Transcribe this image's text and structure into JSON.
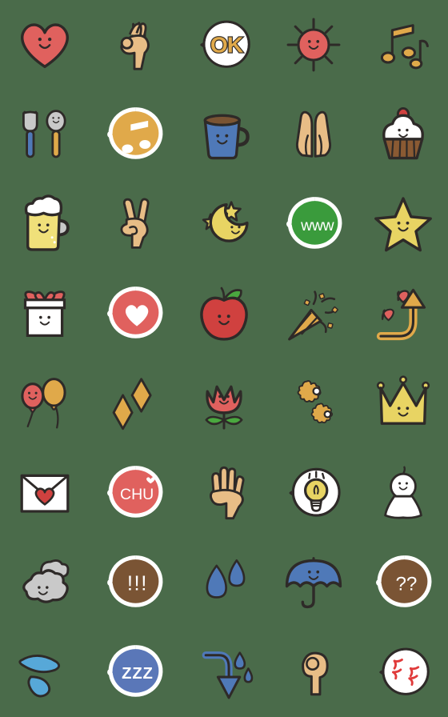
{
  "sheet": {
    "title": "Cute doodle emoji sticker sheet",
    "background_color": "#4a6b4a",
    "columns": 5,
    "rows": 8,
    "cell_size_px": 112,
    "palette": {
      "outline": "#2e2a28",
      "red": "#e0615e",
      "deep_red": "#d0413f",
      "skin": "#e8bd86",
      "gold": "#e0a94a",
      "yellow": "#e8d463",
      "pale_yellow": "#f0e07a",
      "blue": "#4f79b8",
      "deep_blue": "#3a5f9e",
      "light_blue": "#57a8d8",
      "green": "#3a9b3c",
      "leaf_green": "#4aa83f",
      "brown": "#7a5434",
      "dark_brown": "#8a5a33",
      "white": "#ffffff",
      "grey": "#c9c9c9",
      "anger_red": "#e03b3b"
    }
  },
  "emoji": [
    {
      "id": 1,
      "row": 1,
      "col": 1,
      "name": "smiling-heart",
      "label": "Smiling red heart",
      "text": "",
      "colors": [
        "#e0615e"
      ]
    },
    {
      "id": 2,
      "row": 1,
      "col": 2,
      "name": "ok-hand-sign",
      "label": "OK hand gesture",
      "text": "",
      "colors": [
        "#e8bd86"
      ]
    },
    {
      "id": 3,
      "row": 1,
      "col": 3,
      "name": "ok-speech-bubble",
      "label": "OK speech bubble",
      "text": "OK",
      "colors": [
        "#ffffff",
        "#e0a94a"
      ]
    },
    {
      "id": 4,
      "row": 1,
      "col": 4,
      "name": "smiling-sun",
      "label": "Smiling sun",
      "text": "",
      "colors": [
        "#e0615e"
      ]
    },
    {
      "id": 5,
      "row": 1,
      "col": 5,
      "name": "music-notes",
      "label": "Two music notes",
      "text": "",
      "colors": [
        "#e0a94a"
      ]
    },
    {
      "id": 6,
      "row": 2,
      "col": 1,
      "name": "fork-and-spoon",
      "label": "Fork and smiling spoon",
      "text": "",
      "colors": [
        "#c9c9c9",
        "#4f79b8",
        "#e0a94a"
      ]
    },
    {
      "id": 7,
      "row": 2,
      "col": 2,
      "name": "music-note-bubble",
      "label": "Music note speech bubble",
      "text": "",
      "colors": [
        "#e0a94a",
        "#ffffff"
      ]
    },
    {
      "id": 8,
      "row": 2,
      "col": 3,
      "name": "smiling-coffee-mug",
      "label": "Smiling blue coffee mug",
      "text": "",
      "colors": [
        "#4f79b8",
        "#7a5434"
      ]
    },
    {
      "id": 9,
      "row": 2,
      "col": 4,
      "name": "praying-hands",
      "label": "Praying hands",
      "text": "",
      "colors": [
        "#e8bd86"
      ]
    },
    {
      "id": 10,
      "row": 2,
      "col": 5,
      "name": "smiling-cupcake",
      "label": "Smiling cupcake with cherry",
      "text": "",
      "colors": [
        "#ffffff",
        "#8a5a33",
        "#d0413f"
      ]
    },
    {
      "id": 11,
      "row": 3,
      "col": 1,
      "name": "smiling-beer-mug",
      "label": "Smiling beer mug",
      "text": "",
      "colors": [
        "#e8d463",
        "#ffffff"
      ]
    },
    {
      "id": 12,
      "row": 3,
      "col": 2,
      "name": "peace-sign-hand",
      "label": "Peace / victory hand",
      "text": "",
      "colors": [
        "#e8bd86"
      ]
    },
    {
      "id": 13,
      "row": 3,
      "col": 3,
      "name": "crescent-moon-stars",
      "label": "Smiling crescent moon with stars",
      "text": "",
      "colors": [
        "#e8d463"
      ]
    },
    {
      "id": 14,
      "row": 3,
      "col": 4,
      "name": "www-speech-bubble",
      "label": "Laughing www speech bubble",
      "text": "www",
      "colors": [
        "#3a9b3c",
        "#ffffff"
      ]
    },
    {
      "id": 15,
      "row": 3,
      "col": 5,
      "name": "smiling-star",
      "label": "Smiling gold star",
      "text": "",
      "colors": [
        "#e8d463"
      ]
    },
    {
      "id": 16,
      "row": 4,
      "col": 1,
      "name": "smiling-gift-box",
      "label": "Smiling gift box with red ribbon",
      "text": "",
      "colors": [
        "#ffffff",
        "#e0615e"
      ]
    },
    {
      "id": 17,
      "row": 4,
      "col": 2,
      "name": "heart-speech-bubble",
      "label": "Heart speech bubble",
      "text": "",
      "colors": [
        "#e0615e",
        "#ffffff"
      ]
    },
    {
      "id": 18,
      "row": 4,
      "col": 3,
      "name": "smiling-apple",
      "label": "Smiling red apple",
      "text": "",
      "colors": [
        "#d0413f",
        "#4aa83f"
      ]
    },
    {
      "id": 19,
      "row": 4,
      "col": 4,
      "name": "party-popper",
      "label": "Party popper confetti",
      "text": "",
      "colors": [
        "#e0a94a",
        "#2e2a28"
      ]
    },
    {
      "id": 20,
      "row": 4,
      "col": 5,
      "name": "curved-up-arrow-hearts",
      "label": "Curved up arrow with hearts",
      "text": "",
      "colors": [
        "#e0a94a",
        "#e0615e"
      ]
    },
    {
      "id": 21,
      "row": 5,
      "col": 1,
      "name": "balloons",
      "label": "Red smiling balloon and gold balloon",
      "text": "",
      "colors": [
        "#e0615e",
        "#e0a94a"
      ]
    },
    {
      "id": 22,
      "row": 5,
      "col": 2,
      "name": "sparkle-diamonds",
      "label": "Two gold sparkle diamonds",
      "text": "",
      "colors": [
        "#e0a94a"
      ]
    },
    {
      "id": 23,
      "row": 5,
      "col": 3,
      "name": "smiling-tulip",
      "label": "Smiling red tulip",
      "text": "",
      "colors": [
        "#e0615e",
        "#4aa83f"
      ]
    },
    {
      "id": 24,
      "row": 5,
      "col": 4,
      "name": "two-flowers",
      "label": "Two gold daisy flowers",
      "text": "",
      "colors": [
        "#e0a94a"
      ]
    },
    {
      "id": 25,
      "row": 5,
      "col": 5,
      "name": "smiling-crown",
      "label": "Smiling gold crown",
      "text": "",
      "colors": [
        "#e8d463"
      ]
    },
    {
      "id": 26,
      "row": 6,
      "col": 1,
      "name": "love-letter",
      "label": "Envelope with red heart seal",
      "text": "",
      "colors": [
        "#ffffff",
        "#d0413f"
      ]
    },
    {
      "id": 27,
      "row": 6,
      "col": 2,
      "name": "chu-speech-bubble",
      "label": "CHU kiss speech bubble",
      "text": "CHU",
      "colors": [
        "#e0615e",
        "#ffffff"
      ]
    },
    {
      "id": 28,
      "row": 6,
      "col": 3,
      "name": "raised-hand",
      "label": "Raised open hand",
      "text": "",
      "colors": [
        "#e8bd86"
      ]
    },
    {
      "id": 29,
      "row": 6,
      "col": 4,
      "name": "lightbulb-bubble",
      "label": "Light bulb idea speech bubble",
      "text": "",
      "colors": [
        "#ffffff",
        "#e8d463"
      ]
    },
    {
      "id": 30,
      "row": 6,
      "col": 5,
      "name": "teru-teru-bozu",
      "label": "Smiling rain doll",
      "text": "",
      "colors": [
        "#ffffff"
      ]
    },
    {
      "id": 31,
      "row": 7,
      "col": 1,
      "name": "smiling-cloud",
      "label": "Smiling grey cloud",
      "text": "",
      "colors": [
        "#c9c9c9"
      ]
    },
    {
      "id": 32,
      "row": 7,
      "col": 2,
      "name": "exclamation-bubble",
      "label": "Triple exclamation bubble",
      "text": "!!!",
      "colors": [
        "#7a5434",
        "#ffffff"
      ]
    },
    {
      "id": 33,
      "row": 7,
      "col": 3,
      "name": "rain-drops",
      "label": "Two blue rain drops",
      "text": "",
      "colors": [
        "#4f79b8"
      ]
    },
    {
      "id": 34,
      "row": 7,
      "col": 4,
      "name": "smiling-umbrella",
      "label": "Smiling blue umbrella",
      "text": "",
      "colors": [
        "#4f79b8"
      ]
    },
    {
      "id": 35,
      "row": 7,
      "col": 5,
      "name": "question-bubble",
      "label": "Double question mark bubble",
      "text": "??",
      "colors": [
        "#7a5434",
        "#ffffff"
      ]
    },
    {
      "id": 36,
      "row": 8,
      "col": 1,
      "name": "splash-drops",
      "label": "Blue splash drops",
      "text": "",
      "colors": [
        "#57a8d8"
      ]
    },
    {
      "id": 37,
      "row": 8,
      "col": 2,
      "name": "zzz-sleep-bubble",
      "label": "ZZZ sleeping bubble",
      "text": "ZZZ",
      "colors": [
        "#5a77b8",
        "#ffffff"
      ]
    },
    {
      "id": 38,
      "row": 8,
      "col": 3,
      "name": "down-arrow-sweat",
      "label": "Curved down arrow with sweat drops",
      "text": "",
      "colors": [
        "#4f79b8"
      ]
    },
    {
      "id": 39,
      "row": 8,
      "col": 4,
      "name": "fist-hand",
      "label": "Raised fist",
      "text": "",
      "colors": [
        "#e8bd86"
      ]
    },
    {
      "id": 40,
      "row": 8,
      "col": 5,
      "name": "anger-bubble",
      "label": "Anger veins speech bubble",
      "text": "",
      "colors": [
        "#ffffff",
        "#e03b3b"
      ]
    }
  ]
}
